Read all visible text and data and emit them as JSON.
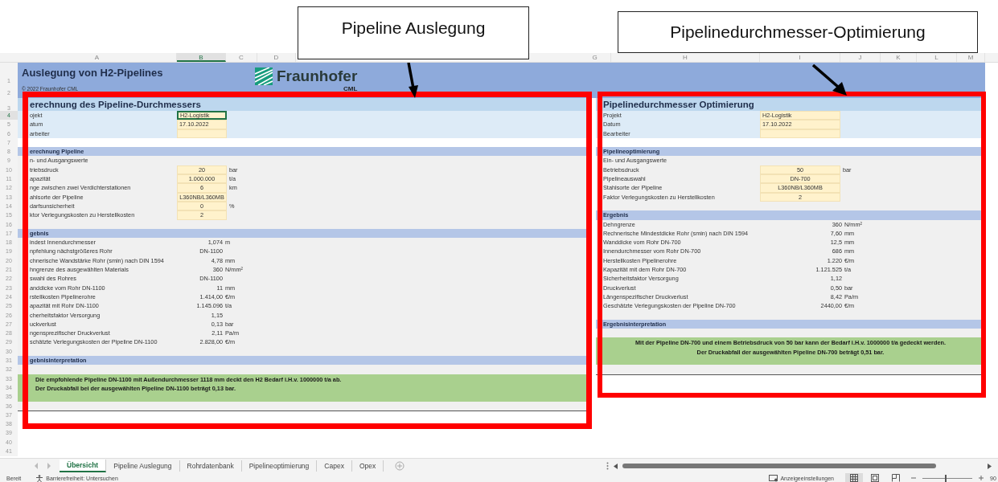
{
  "callouts": [
    {
      "text": "Pipeline Auslegung"
    },
    {
      "text": "Pipelinedurchmesser-Optimierung"
    }
  ],
  "columns": [
    {
      "label": "A",
      "selected": false
    },
    {
      "label": "B",
      "selected": true
    },
    {
      "label": "C",
      "selected": false
    },
    {
      "label": "D",
      "selected": false
    },
    {
      "label": "G",
      "selected": false
    },
    {
      "label": "H",
      "selected": false
    },
    {
      "label": "I",
      "selected": false
    },
    {
      "label": "J",
      "selected": false
    },
    {
      "label": "K",
      "selected": false
    },
    {
      "label": "L",
      "selected": false
    },
    {
      "label": "M",
      "selected": false
    }
  ],
  "row_numbers": [
    {
      "label": "1",
      "selected": false
    },
    {
      "label": "2",
      "selected": false
    },
    {
      "label": "3",
      "selected": false
    },
    {
      "label": "4",
      "selected": true
    },
    {
      "label": "5",
      "selected": false
    },
    {
      "label": "6",
      "selected": false
    },
    {
      "label": "7",
      "selected": false
    },
    {
      "label": "8",
      "selected": false
    },
    {
      "label": "9",
      "selected": false
    },
    {
      "label": "10",
      "selected": false
    },
    {
      "label": "11",
      "selected": false
    },
    {
      "label": "12",
      "selected": false
    },
    {
      "label": "13",
      "selected": false
    },
    {
      "label": "14",
      "selected": false
    },
    {
      "label": "15",
      "selected": false
    },
    {
      "label": "16",
      "selected": false
    },
    {
      "label": "17",
      "selected": false
    },
    {
      "label": "18",
      "selected": false
    },
    {
      "label": "19",
      "selected": false
    },
    {
      "label": "20",
      "selected": false
    },
    {
      "label": "21",
      "selected": false
    },
    {
      "label": "22",
      "selected": false
    },
    {
      "label": "23",
      "selected": false
    },
    {
      "label": "24",
      "selected": false
    },
    {
      "label": "25",
      "selected": false
    },
    {
      "label": "26",
      "selected": false
    },
    {
      "label": "27",
      "selected": false
    },
    {
      "label": "28",
      "selected": false
    },
    {
      "label": "29",
      "selected": false
    },
    {
      "label": "30",
      "selected": false
    },
    {
      "label": "31",
      "selected": false
    },
    {
      "label": "32",
      "selected": false
    },
    {
      "label": "33",
      "selected": false
    },
    {
      "label": "34",
      "selected": false
    },
    {
      "label": "35",
      "selected": false
    },
    {
      "label": "36",
      "selected": false
    },
    {
      "label": "37",
      "selected": false
    },
    {
      "label": "38",
      "selected": false
    },
    {
      "label": "39",
      "selected": false
    },
    {
      "label": "40",
      "selected": false
    },
    {
      "label": "41",
      "selected": false
    }
  ],
  "banner": {
    "title": "Auslegung von H2-Pipelines",
    "copyright": "© 2022 Fraunhofer CML",
    "logo_text": "Fraunhofer",
    "logo_sub": "CML"
  },
  "left": {
    "title": "erechnung des Pipeline-Durchmessers",
    "info": [
      {
        "label": "ojekt",
        "value": "H2-Logistik",
        "selected": true
      },
      {
        "label": "atum",
        "value": "17.10.2022",
        "selected": false
      },
      {
        "label": "arbeiter",
        "selected": false
      }
    ],
    "body": [
      {
        "kind": "section",
        "label": "erechnung Pipeline"
      },
      {
        "kind": "text",
        "label": "n- und Ausgangswerte"
      },
      {
        "kind": "input",
        "label": "triebsdruck",
        "value": "20",
        "unit": "bar"
      },
      {
        "kind": "input",
        "label": "apazität",
        "value": "1.000.000",
        "unit": "t/a"
      },
      {
        "kind": "input",
        "label": "nge zwischen zwei Verdichterstationen",
        "value": "6",
        "unit": "km"
      },
      {
        "kind": "input",
        "label": "ahlsorte der Pipeline",
        "value": "L360NB/L360MB"
      },
      {
        "kind": "input",
        "label": "darfsunsicherheit",
        "value": "0",
        "unit": "%"
      },
      {
        "kind": "input",
        "label": "ktor Verlegungskosten zu Herstellkosten",
        "value": "2"
      },
      {
        "kind": "blank"
      },
      {
        "kind": "section",
        "label": "gebnis"
      },
      {
        "kind": "result",
        "label": "indest Innendurchmesser",
        "value": "1,074",
        "unit": "m"
      },
      {
        "kind": "result",
        "label": "npfehlung nächstgrößeres Rohr",
        "value": "DN-1100"
      },
      {
        "kind": "result",
        "label": "chnerische Wandstärke Rohr (smin) nach DIN 1594",
        "value": "4,78",
        "unit": "mm"
      },
      {
        "kind": "result",
        "label": "hngrenze des ausgewählten Materials",
        "value": "360",
        "unit": "N/mm²"
      },
      {
        "kind": "result",
        "label": "swahl des Rohres",
        "value": "DN-1100"
      },
      {
        "kind": "result",
        "label": "anddicke vom Rohr DN-1100",
        "value": "11",
        "unit": "mm"
      },
      {
        "kind": "result",
        "label": "rstellkosten Pipelinerohre",
        "value": "1.414,00",
        "unit": "€/m"
      },
      {
        "kind": "result",
        "label": "apazität mit Rohr DN-1100",
        "value": "1.145.096",
        "unit": "t/a"
      },
      {
        "kind": "result",
        "label": "cherheitsfaktor Versorgung",
        "value": "1,15"
      },
      {
        "kind": "result",
        "label": "uckverlust",
        "value": "0,13",
        "unit": "bar"
      },
      {
        "kind": "result",
        "label": "ngensprezifischer Druckverlust",
        "value": "2,11",
        "unit": "Pa/m"
      },
      {
        "kind": "result",
        "label": "schätzte Verlegungskosten der Pipeline DN-1100",
        "value": "2.828,00",
        "unit": "€/m"
      },
      {
        "kind": "blank"
      },
      {
        "kind": "section",
        "label": "gebnisinterpretation"
      },
      {
        "kind": "blank"
      },
      {
        "kind": "note",
        "lines": [
          "Die empfohlende Pipeline DN-1100 mit Außendurchmesser 1118 mm deckt den H2 Bedarf i.H.v. 1000000 t/a ab.",
          "Der Druckabfall bei der ausgewählten Pipeline DN-1100 beträgt 0,13 bar."
        ]
      },
      {
        "kind": "blank"
      }
    ]
  },
  "right": {
    "title": "Pipelinedurchmesser Optimierung",
    "info": [
      {
        "label": "Projekt",
        "value": "H2-Logistik",
        "selected": false
      },
      {
        "label": "Datum",
        "value": "17.10.2022",
        "selected": false
      },
      {
        "label": "Bearbeiter",
        "selected": false
      }
    ],
    "body": [
      {
        "kind": "section",
        "label": "Pipelineoptimierung"
      },
      {
        "kind": "text",
        "label": "Ein- und Ausgangswerte"
      },
      {
        "kind": "input",
        "label": "Betriebsdruck",
        "value": "50",
        "unit": "bar"
      },
      {
        "kind": "input",
        "label": "Pipelineauswahl",
        "value": "DN-700"
      },
      {
        "kind": "input",
        "label": "Stahlsorte der Pipeline",
        "value": "L360NB/L360MB"
      },
      {
        "kind": "input",
        "label": "Faktor Verlegungskosten zu Herstellkosten",
        "value": "2"
      },
      {
        "kind": "blank"
      },
      {
        "kind": "section",
        "label": "Ergebnis"
      },
      {
        "kind": "result",
        "label": "Dehngrenze",
        "value": "360",
        "unit": "N/mm²"
      },
      {
        "kind": "result",
        "label": "Rechnerische Mindestdicke Rohr (smin) nach DIN 1594",
        "value": "7,60",
        "unit": "mm"
      },
      {
        "kind": "result",
        "label": "Wanddicke vom Rohr DN-700",
        "value": "12,5",
        "unit": "mm"
      },
      {
        "kind": "result",
        "label": "Innendurchmesser vom Rohr DN-700",
        "value": "686",
        "unit": "mm"
      },
      {
        "kind": "result",
        "label": "Herstellkosten Pipelinerohre",
        "value": "1.220",
        "unit": "€/m"
      },
      {
        "kind": "result",
        "label": "Kapazität mit dem Rohr DN-700",
        "value": "1.121.525",
        "unit": "t/a"
      },
      {
        "kind": "result",
        "label": "Sicherheitsfaktor Versorgung",
        "value": "1,12"
      },
      {
        "kind": "result",
        "label": "Druckverlust",
        "value": "0,50",
        "unit": "bar"
      },
      {
        "kind": "result",
        "label": "Längenspezifischer Druckverlust",
        "value": "8,42",
        "unit": "Pa/m"
      },
      {
        "kind": "result",
        "label": "Geschätzte Verlegungskosten der Pipeline DN-700",
        "value": "2440,00",
        "unit": "€/m"
      },
      {
        "kind": "blank"
      },
      {
        "kind": "section",
        "label": "Ergebnisinterpretation"
      },
      {
        "kind": "blank"
      },
      {
        "kind": "note",
        "lines": [
          "Mit der Pipeline DN-700 und einem Betriebsdruck von 50 bar kann der Bedarf i.H.v. 1000000 t/a gedeckt werden.",
          "Der Druckabfall der ausgewählten Pipeline DN-700 beträgt 0,51 bar."
        ]
      },
      {
        "kind": "blank"
      }
    ]
  },
  "sheet_tabs": [
    {
      "label": "Übersicht",
      "selected": true
    },
    {
      "label": "Pipeline Auslegung",
      "selected": false
    },
    {
      "label": "Rohrdatenbank",
      "selected": false
    },
    {
      "label": "Pipelineoptimierung",
      "selected": false
    },
    {
      "label": "Capex",
      "selected": false
    },
    {
      "label": "Opex",
      "selected": false
    }
  ],
  "status_bar": {
    "state": "Bereit",
    "accessibility": "Barrierefreiheit: Untersuchen",
    "display_settings": "Anzeigeeinstellungen",
    "views": [
      {
        "kind": "normal",
        "selected": true
      },
      {
        "kind": "page_layout",
        "selected": false
      },
      {
        "kind": "page_break",
        "selected": false
      }
    ],
    "zoom": {
      "level": 0.45,
      "reading": "90"
    }
  }
}
